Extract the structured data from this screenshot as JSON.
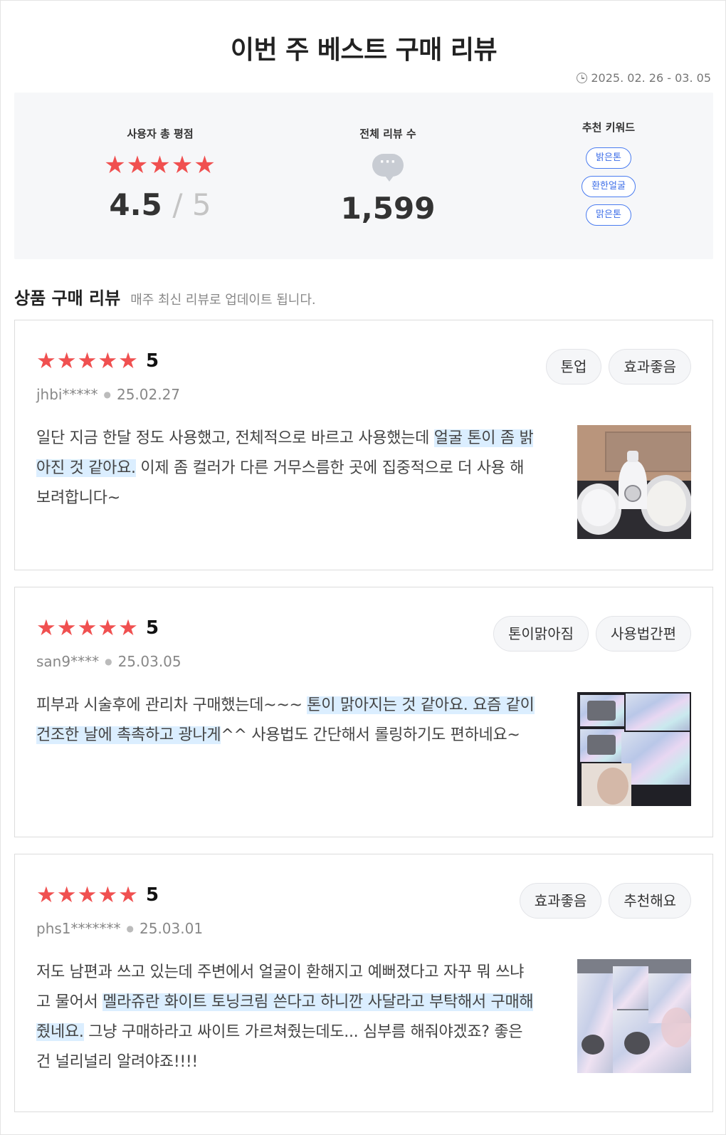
{
  "header": {
    "title": "이번 주 베스트 구매 리뷰",
    "period": "2025. 02. 26 - 03. 05"
  },
  "summary": {
    "rating_label": "사용자 총 평점",
    "rating_stars": "★★★★★",
    "rating_value": "4.5",
    "rating_max": "/ 5",
    "count_label": "전체 리뷰 수",
    "count_icon_text": "···",
    "count_value": "1,599",
    "keywords_label": "추천 키워드",
    "keywords": [
      "밝은톤",
      "환한얼굴",
      "맑은톤"
    ]
  },
  "section": {
    "title": "상품 구매 리뷰",
    "subtitle": "매주 최신 리뷰로 업데이트 됩니다."
  },
  "reviews": [
    {
      "stars": "★★★★★",
      "score": "5",
      "user": "jhbi*****",
      "date": "25.02.27",
      "tags": [
        "톤업",
        "효과좋음"
      ],
      "text_before": "일단 지금 한달 정도 사용했고, 전체적으로 바르고 사용했는데 ",
      "text_highlight": "얼굴 톤이 좀 밝아진 것 같아요.",
      "text_after": " 이제 좀 컬러가 다른 거무스름한 곳에 집중적으로 더 사용 해보려합니다~"
    },
    {
      "stars": "★★★★★",
      "score": "5",
      "user": "san9****",
      "date": "25.03.05",
      "tags": [
        "톤이맑아짐",
        "사용법간편"
      ],
      "text_before": "피부과 시술후에 관리차 구매했는데~~~ ",
      "text_highlight": "톤이 맑아지는 것 같아요. 요즘 같이 건조한 날에 촉촉하고 광나게",
      "text_after": "^^ 사용법도 간단해서 롤링하기도 편하네요~"
    },
    {
      "stars": "★★★★★",
      "score": "5",
      "user": "phs1*******",
      "date": "25.03.01",
      "tags": [
        "효과좋음",
        "추천해요"
      ],
      "text_before": "저도 남편과 쓰고 있는데 주변에서 얼굴이 환해지고 예뻐졌다고 자꾸 뭐 쓰냐고 물어서 ",
      "text_highlight": "멜라쥬란 화이트 토닝크림 쓴다고 하니깐 사달라고 부탁해서 구매해줬네요.",
      "text_after": " 그냥 구매하라고 싸이트 가르쳐줬는데도... 심부름 해줘야겠죠? 좋은건 널리널리 알려야죠!!!!"
    }
  ]
}
